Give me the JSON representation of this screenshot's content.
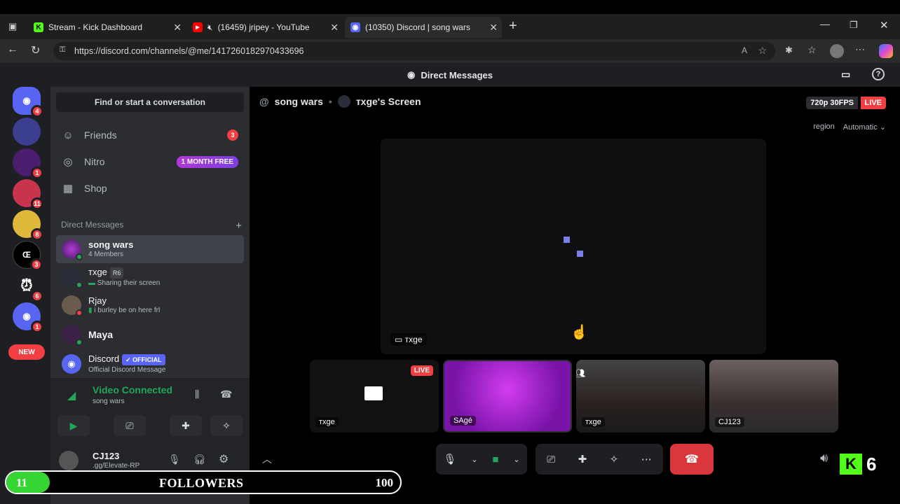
{
  "browser": {
    "tabs": [
      {
        "title": "Stream - Kick Dashboard",
        "fav": "K",
        "fav_color": "#53fc18"
      },
      {
        "title": "(16459) jripey - YouTube",
        "fav": "▶",
        "fav_color": "#ff0000"
      },
      {
        "title": "(10350) Discord | song wars",
        "fav": "◉",
        "fav_color": "#5865f2"
      }
    ],
    "url": "https://discord.com/channels/@me/1417260182970433696"
  },
  "discord": {
    "title": "Direct Messages",
    "rail_badges": [
      "4",
      "1",
      "11",
      "8",
      "3",
      "6",
      "1"
    ],
    "new_label": "NEW",
    "find_placeholder": "Find or start a conversation",
    "nav": {
      "friends": "Friends",
      "friends_badge": "3",
      "nitro": "Nitro",
      "nitro_badge": "1 MONTH FREE",
      "shop": "Shop"
    },
    "dm_header": "Direct Messages",
    "dms": [
      {
        "name": "song wars",
        "sub": "4 Members"
      },
      {
        "name": "тxge",
        "tag": "R6",
        "sub": "Sharing their screen"
      },
      {
        "name": "Rjay",
        "sub": "i burley be on here frl"
      },
      {
        "name": "Maya",
        "sub": ""
      },
      {
        "name": "Discord",
        "tag": "OFFICIAL",
        "sub": "Official Discord Message"
      }
    ],
    "voice": {
      "status": "Video Connected",
      "channel": "song wars"
    },
    "user": {
      "name": "CJ123",
      "sub": ".gg/Elevate-RP"
    },
    "stage": {
      "channel": "song wars",
      "screen_title": "тxge's Screen",
      "quality": "720p 30FPS",
      "live": "LIVE",
      "region_label": "region",
      "region_value": "Automatic",
      "screen_owner": "тxge",
      "tiles": [
        {
          "name": "тxge",
          "live": "LIVE"
        },
        {
          "name": "SAgé"
        },
        {
          "name": "тxge"
        },
        {
          "name": "CJ123"
        }
      ]
    }
  },
  "overlay": {
    "followers_current": "11",
    "followers_label": "FOLLOWERS",
    "followers_goal": "100",
    "followers_fraction": 0.11,
    "kick_count": "6"
  }
}
